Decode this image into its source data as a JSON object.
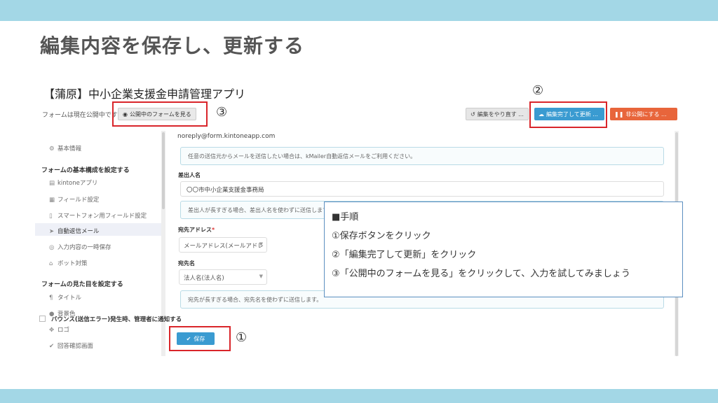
{
  "slide": {
    "title": "編集内容を保存し、更新する"
  },
  "app": {
    "title": "【蒲原】中小企業支援金申請管理アプリ",
    "form_status": "フォームは現在公開中です",
    "buttons": {
      "view_public": "公開中のフォームを見る",
      "redo": "編集をやり直す ...",
      "done_update": "編集完了して更新 ...",
      "unpublish": "非公開にする ..."
    }
  },
  "sidebar": {
    "items": [
      {
        "icon": "gear-icon",
        "label": "基本情報"
      },
      {
        "heading": "フォームの基本構成を設定する"
      },
      {
        "icon": "file-icon",
        "label": "kintoneアプリ"
      },
      {
        "icon": "grid-icon",
        "label": "フィールド設定"
      },
      {
        "icon": "phone-icon",
        "label": "スマートフォン用フィールド設定"
      },
      {
        "icon": "send-icon",
        "label": "自動返信メール"
      },
      {
        "icon": "list-icon",
        "label": "入力内容の一時保存"
      },
      {
        "icon": "robot-icon",
        "label": "ボット対策"
      },
      {
        "heading": "フォームの見た目を設定する"
      },
      {
        "icon": "paragraph-icon",
        "label": "タイトル"
      },
      {
        "icon": "drop-icon",
        "label": "背景色"
      },
      {
        "icon": "logo-icon",
        "label": "ロゴ"
      },
      {
        "icon": "check-icon",
        "label": "回答確認画面"
      }
    ]
  },
  "content": {
    "email": "noreply@form.kintoneapp.com",
    "info_sender": "任意の送信元からメールを送信したい場合は、kMailer自動返信メールをご利用ください。",
    "sender_label": "差出人名",
    "sender_value": "〇〇市中小企業支援金事務局",
    "info_sender_long": "差出人が長すぎる場合、差出人名を使わずに送信します。",
    "to_address_label": "宛先アドレス",
    "to_address_required": "*",
    "to_address_value": "メールアドレス(メールアドレ",
    "to_name_label": "宛先名",
    "to_name_value": "法人名(法人名)",
    "info_to_long": "宛先が長すぎる場合、宛先名を使わずに送信します。",
    "bounce_label": "バウンス(送信エラー)発生時、管理者に通知する",
    "save_label": "保存"
  },
  "annotations": {
    "n1": "①",
    "n2": "②",
    "n3": "③"
  },
  "steps": {
    "heading": "■手順",
    "step1": "①保存ボタンをクリック",
    "step2": "②「編集完了して更新」をクリック",
    "step3": "③「公開中のフォームを見る」をクリックして、入力を試してみましょう"
  },
  "colors": {
    "band": "#a3d7e6",
    "primary": "#3a9bd1",
    "danger": "#e8653b",
    "highlight": "#d9252a"
  }
}
